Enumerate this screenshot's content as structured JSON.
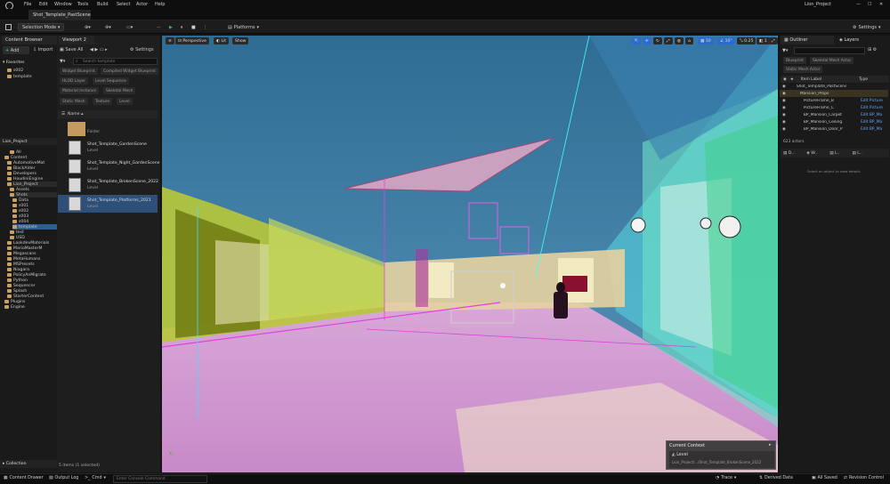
{
  "menu": [
    "File",
    "Edit",
    "Window",
    "Tools",
    "Build",
    "Select",
    "Actor",
    "Help"
  ],
  "project_name": "Lion_Project",
  "document_tab": "Shot_Template_PastScene",
  "toolbar": {
    "selection_mode": "Selection Mode",
    "platforms": "Platforms",
    "settings": "Settings"
  },
  "content_browser": {
    "tab": "Content Browser",
    "add": "Add",
    "import": "Import",
    "save_all": "Save All",
    "settings": "Settings",
    "search_placeholder": "Search template",
    "favorites": {
      "title": "Favorites",
      "items": [
        "s002",
        "template"
      ]
    },
    "project_tree_title": "Lion_Project",
    "tree": [
      "All",
      "Content",
      "AutomotiveMat",
      "BlackAlder",
      "Developers",
      "HoudiniEngine",
      "Lion_Project",
      "Assets",
      "Shots",
      "Data",
      "s001",
      "s002",
      "s003",
      "s004",
      "template",
      "test",
      "USD",
      "LookdevMaterials",
      "MarioMasterM",
      "Megascans",
      "MetaHumans",
      "MSPresets",
      "Niagara",
      "PolicyAnMigrate",
      "Python",
      "Sequencer",
      "Splash",
      "StarterContent",
      "Plugins",
      "Engine"
    ],
    "filters": [
      "Widget Blueprint",
      "Compiled Widget Blueprint",
      "HLOD Layer",
      "Level Sequence",
      "Material Instance",
      "Skeletal Mesh",
      "Static Mesh",
      "Texture",
      "Level"
    ],
    "column": "Name",
    "assets": [
      {
        "name": "",
        "type": "Folder"
      },
      {
        "name": "Shot_Template_GardenScene",
        "type": "Level"
      },
      {
        "name": "Shot_Template_Night_GardenScene",
        "type": "Level"
      },
      {
        "name": "Shot_Template_BrokenScene_2022",
        "type": "Level"
      },
      {
        "name": "Shot_Template_Platforms_2021",
        "type": "Level"
      }
    ],
    "status": "5 items (1 selected)",
    "collection": "Collection"
  },
  "viewport": {
    "tab": "Viewport 2",
    "perspective": "Perspective",
    "lit": "Lit",
    "show": "Show",
    "grid_snap": "10",
    "angle_snap": "10°",
    "scale_snap": "0.25",
    "camera_speed": "1",
    "current_context_title": "Current Context",
    "current_context_level": "Level",
    "current_context_path": "Lion_Project/.../Shot_Template_BrokenScene_2022"
  },
  "outliner": {
    "tab": "Outliner",
    "layers_tab": "Layers",
    "filters": [
      "Blueprint",
      "Skeletal Mesh Actor",
      "Static Mesh Actor"
    ],
    "col_label": "Item Label",
    "col_type": "Type",
    "rows": [
      {
        "label": "Shot_Template_PastScene (Editor)",
        "type": ""
      },
      {
        "label": "Mansion_Props",
        "type": ""
      },
      {
        "label": "PictureFrame_B",
        "type": "Edit Picture"
      },
      {
        "label": "PictureFrame_C",
        "type": "Edit Picture"
      },
      {
        "label": "BP_Mansion_Carpet",
        "type": "Edit BP_Ma"
      },
      {
        "label": "BP_Mansion_Ceiling",
        "type": "Edit BP_Ma"
      },
      {
        "label": "BP_Mansion_Door_P",
        "type": "Edit BP_Ma"
      }
    ],
    "actors_count": "623 actors",
    "details_hint": "Select an object to view details."
  },
  "bottom": {
    "content_drawer": "Content Drawer",
    "output_log": "Output Log",
    "cmd": "Cmd",
    "console_placeholder": "Enter Console Command",
    "trace": "Trace",
    "derived_data": "Derived Data",
    "all_saved": "All Saved",
    "revision_control": "Revision Control"
  }
}
